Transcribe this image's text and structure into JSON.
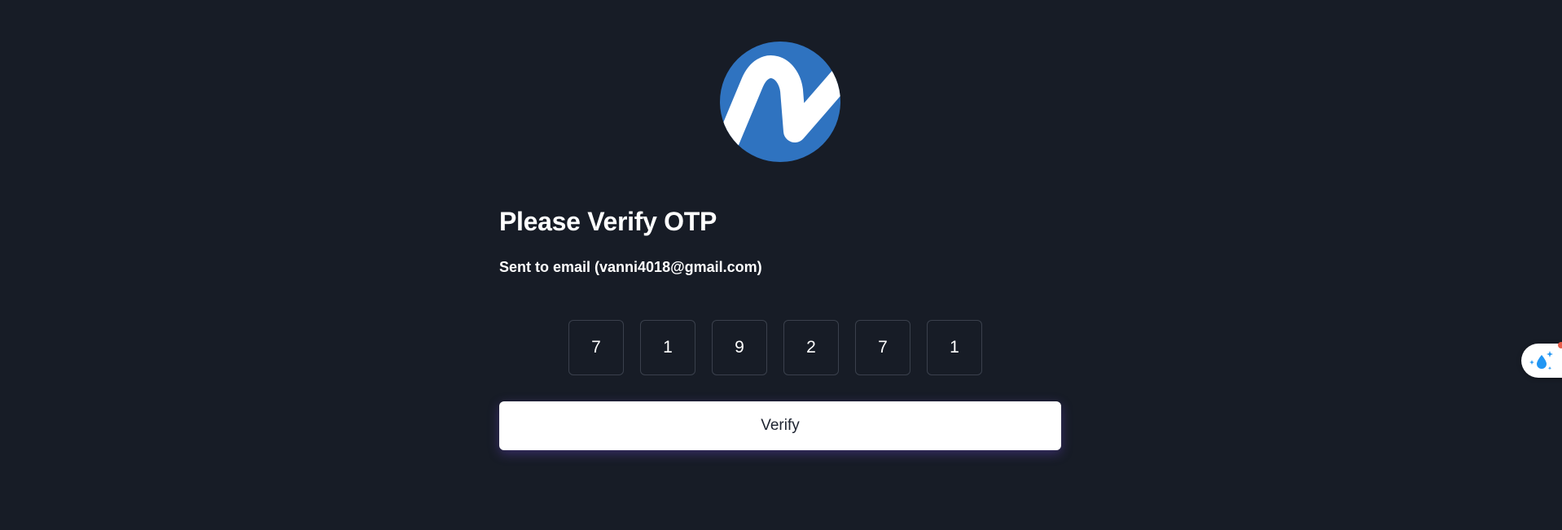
{
  "logo": {
    "icon": "brand-logo-icon",
    "circle_color": "#2f73c0",
    "wave_color": "#ffffff"
  },
  "heading": "Please Verify OTP",
  "subheading": "Sent to email (vanni4018@gmail.com)",
  "otp": {
    "digits": [
      "7",
      "1",
      "9",
      "2",
      "7",
      "1"
    ]
  },
  "verify_button": {
    "label": "Verify"
  },
  "extension_widget": {
    "icon": "sparkle-drop-icon",
    "accent": "#2196f3",
    "badge_color": "#e85d4a"
  },
  "colors": {
    "background": "#171c26",
    "text": "#ffffff",
    "button_bg": "#ffffff",
    "button_text": "#1d2330",
    "otp_border": "#3a404c"
  }
}
